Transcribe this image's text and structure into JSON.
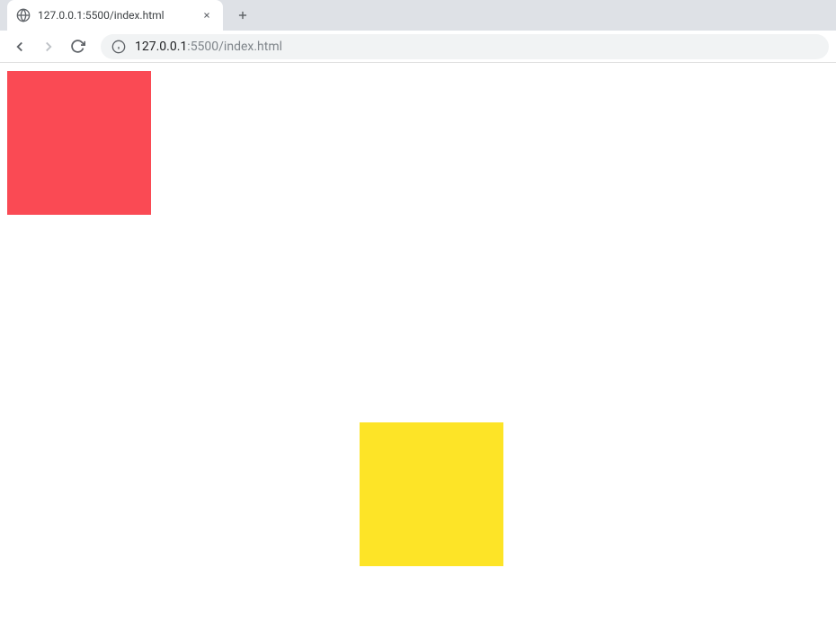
{
  "browser": {
    "tab": {
      "title": "127.0.0.1:5500/index.html"
    },
    "address": {
      "host": "127.0.0.1",
      "port_path": ":5500/index.html"
    }
  }
}
